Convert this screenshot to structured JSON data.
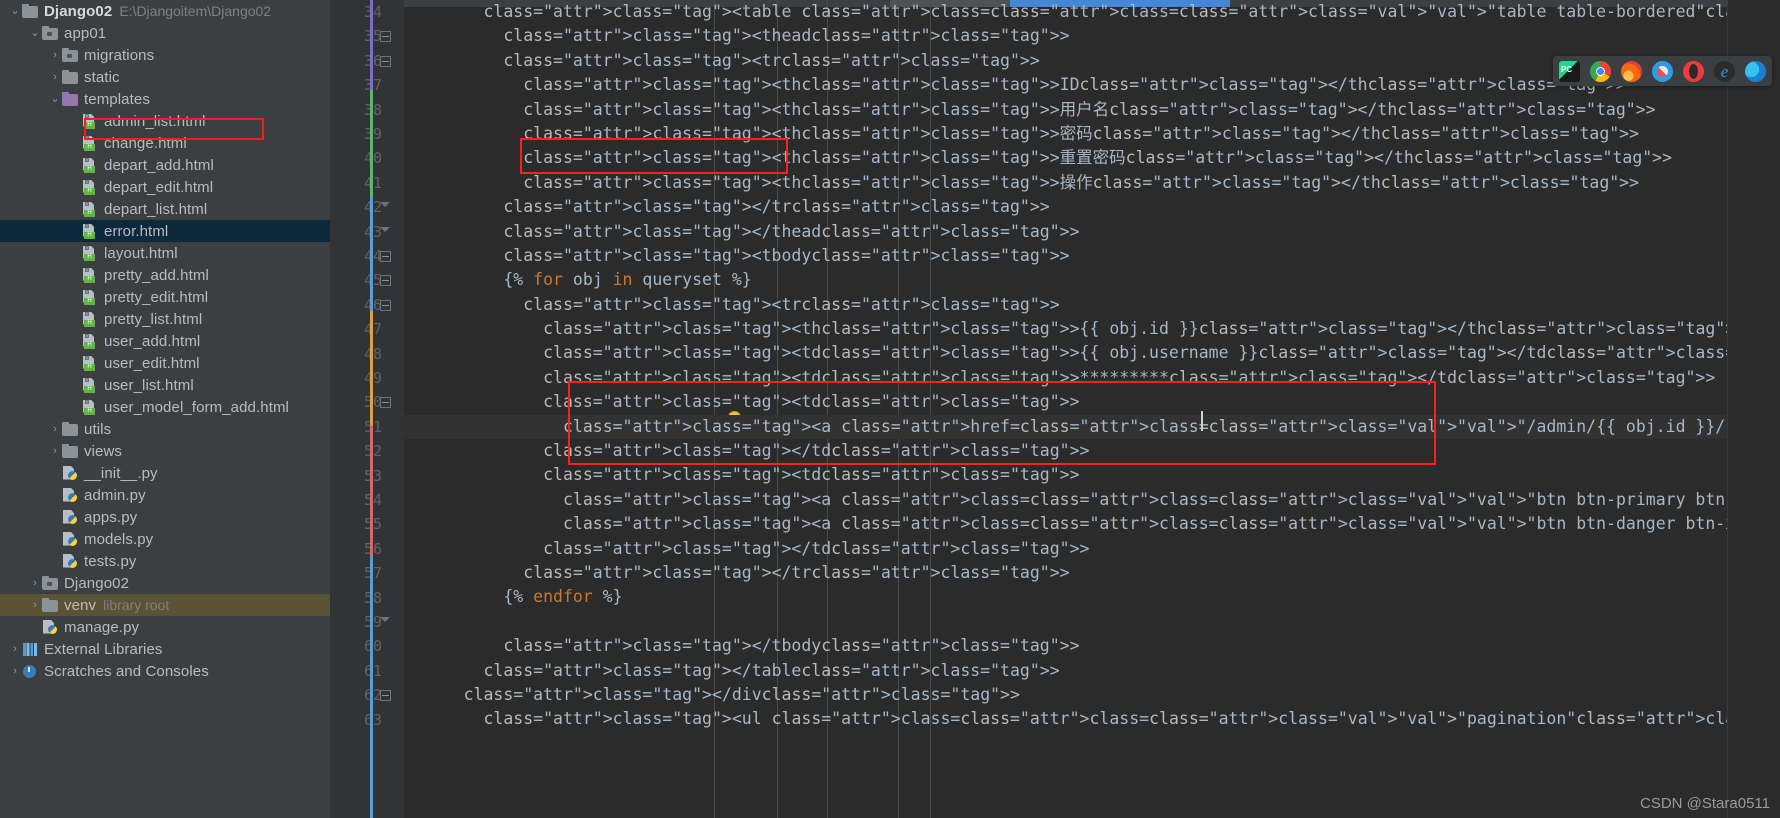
{
  "project": {
    "root": {
      "name": "Django02",
      "path": "E:\\Djangoitem\\Django02"
    },
    "items": [
      {
        "label": "Django02",
        "sub": "E:\\Djangoitem\\Django02",
        "icon": "folder-icon",
        "arrow": "⌄",
        "depth": 0,
        "bold": true
      },
      {
        "label": "app01",
        "sub": "",
        "icon": "module-folder-icon",
        "arrow": "⌄",
        "depth": 1,
        "bold": false
      },
      {
        "label": "migrations",
        "sub": "",
        "icon": "module-folder-icon",
        "arrow": "›",
        "depth": 2,
        "bold": false
      },
      {
        "label": "static",
        "sub": "",
        "icon": "folder-icon",
        "arrow": "›",
        "depth": 2,
        "bold": false
      },
      {
        "label": "templates",
        "sub": "",
        "icon": "templates-folder-icon",
        "arrow": "⌄",
        "depth": 2,
        "bold": false
      },
      {
        "label": "admin_list.html",
        "sub": "",
        "icon": "html-file-icon",
        "arrow": "",
        "depth": 3,
        "bold": false
      },
      {
        "label": "change.html",
        "sub": "",
        "icon": "html-file-icon",
        "arrow": "",
        "depth": 3,
        "bold": false
      },
      {
        "label": "depart_add.html",
        "sub": "",
        "icon": "html-file-icon",
        "arrow": "",
        "depth": 3,
        "bold": false
      },
      {
        "label": "depart_edit.html",
        "sub": "",
        "icon": "html-file-icon",
        "arrow": "",
        "depth": 3,
        "bold": false
      },
      {
        "label": "depart_list.html",
        "sub": "",
        "icon": "html-file-icon",
        "arrow": "",
        "depth": 3,
        "bold": false
      },
      {
        "label": "error.html",
        "sub": "",
        "icon": "html-file-icon",
        "arrow": "",
        "depth": 3,
        "bold": false,
        "selected": true
      },
      {
        "label": "layout.html",
        "sub": "",
        "icon": "html-file-icon",
        "arrow": "",
        "depth": 3,
        "bold": false
      },
      {
        "label": "pretty_add.html",
        "sub": "",
        "icon": "html-file-icon",
        "arrow": "",
        "depth": 3,
        "bold": false
      },
      {
        "label": "pretty_edit.html",
        "sub": "",
        "icon": "html-file-icon",
        "arrow": "",
        "depth": 3,
        "bold": false
      },
      {
        "label": "pretty_list.html",
        "sub": "",
        "icon": "html-file-icon",
        "arrow": "",
        "depth": 3,
        "bold": false
      },
      {
        "label": "user_add.html",
        "sub": "",
        "icon": "html-file-icon",
        "arrow": "",
        "depth": 3,
        "bold": false
      },
      {
        "label": "user_edit.html",
        "sub": "",
        "icon": "html-file-icon",
        "arrow": "",
        "depth": 3,
        "bold": false
      },
      {
        "label": "user_list.html",
        "sub": "",
        "icon": "html-file-icon",
        "arrow": "",
        "depth": 3,
        "bold": false
      },
      {
        "label": "user_model_form_add.html",
        "sub": "",
        "icon": "html-file-icon",
        "arrow": "",
        "depth": 3,
        "bold": false
      },
      {
        "label": "utils",
        "sub": "",
        "icon": "folder-icon",
        "arrow": "›",
        "depth": 2,
        "bold": false
      },
      {
        "label": "views",
        "sub": "",
        "icon": "folder-icon",
        "arrow": "›",
        "depth": 2,
        "bold": false
      },
      {
        "label": "__init__.py",
        "sub": "",
        "icon": "python-file-icon",
        "arrow": "",
        "depth": 2,
        "bold": false
      },
      {
        "label": "admin.py",
        "sub": "",
        "icon": "python-file-icon",
        "arrow": "",
        "depth": 2,
        "bold": false
      },
      {
        "label": "apps.py",
        "sub": "",
        "icon": "python-file-icon",
        "arrow": "",
        "depth": 2,
        "bold": false
      },
      {
        "label": "models.py",
        "sub": "",
        "icon": "python-file-icon",
        "arrow": "",
        "depth": 2,
        "bold": false
      },
      {
        "label": "tests.py",
        "sub": "",
        "icon": "python-file-icon",
        "arrow": "",
        "depth": 2,
        "bold": false
      },
      {
        "label": "Django02",
        "sub": "",
        "icon": "module-folder-icon",
        "arrow": "›",
        "depth": 1,
        "bold": false
      },
      {
        "label": "venv",
        "sub": "library root",
        "icon": "folder-icon",
        "arrow": "›",
        "depth": 1,
        "bold": false,
        "venv": true
      },
      {
        "label": "manage.py",
        "sub": "",
        "icon": "python-file-icon",
        "arrow": "",
        "depth": 1,
        "bold": false
      },
      {
        "label": "External Libraries",
        "sub": "",
        "icon": "external-libraries-icon",
        "arrow": "›",
        "depth": 0,
        "bold": false
      },
      {
        "label": "Scratches and Consoles",
        "sub": "",
        "icon": "scratches-icon",
        "arrow": "›",
        "depth": 0,
        "bold": false
      }
    ]
  },
  "editor": {
    "first_line": 34,
    "current_line": 51,
    "lines": [
      {
        "n": 34,
        "indent": 8,
        "text": "<table class=\"table table-bordered\">"
      },
      {
        "n": 35,
        "indent": 10,
        "text": "<thead>"
      },
      {
        "n": 36,
        "indent": 10,
        "text": "<tr>"
      },
      {
        "n": 37,
        "indent": 12,
        "text": "<th>ID</th>"
      },
      {
        "n": 38,
        "indent": 12,
        "text": "<th>用户名</th>"
      },
      {
        "n": 39,
        "indent": 12,
        "text": "<th>密码</th>"
      },
      {
        "n": 40,
        "indent": 12,
        "text": "<th>重置密码</th>"
      },
      {
        "n": 41,
        "indent": 12,
        "text": "<th>操作</th>"
      },
      {
        "n": 42,
        "indent": 10,
        "text": "</tr>"
      },
      {
        "n": 43,
        "indent": 10,
        "text": "</thead>"
      },
      {
        "n": 44,
        "indent": 10,
        "text": "<tbody>"
      },
      {
        "n": 45,
        "indent": 10,
        "text": "{% for obj in queryset %}"
      },
      {
        "n": 46,
        "indent": 12,
        "text": "<tr>"
      },
      {
        "n": 47,
        "indent": 14,
        "text": "<th>{{ obj.id }}</th>"
      },
      {
        "n": 48,
        "indent": 14,
        "text": "<td>{{ obj.username }}</td>"
      },
      {
        "n": 49,
        "indent": 14,
        "text": "<td>*********</td>"
      },
      {
        "n": 50,
        "indent": 14,
        "text": "<td>"
      },
      {
        "n": 51,
        "indent": 16,
        "text": "<a href=\"/admin/{{ obj.id }}/reset/\">重置密码</a>"
      },
      {
        "n": 52,
        "indent": 14,
        "text": "</td>"
      },
      {
        "n": 53,
        "indent": 14,
        "text": "<td>"
      },
      {
        "n": 54,
        "indent": 16,
        "text": "<a class=\"btn btn-primary btn-xs\" href=\"/admin/{{ obj.id }}/edit/\">编辑</a>"
      },
      {
        "n": 55,
        "indent": 16,
        "text": "<a class=\"btn btn-danger btn-xs\" href=\"/admin/{{ obj.id }}/delete/\">删除</a>"
      },
      {
        "n": 56,
        "indent": 14,
        "text": "</td>"
      },
      {
        "n": 57,
        "indent": 12,
        "text": "</tr>"
      },
      {
        "n": 58,
        "indent": 10,
        "text": "{% endfor %}"
      },
      {
        "n": 59,
        "indent": 0,
        "text": ""
      },
      {
        "n": 60,
        "indent": 10,
        "text": "</tbody>"
      },
      {
        "n": 61,
        "indent": 8,
        "text": "</table>"
      },
      {
        "n": 62,
        "indent": 6,
        "text": "</div>"
      },
      {
        "n": 63,
        "indent": 8,
        "text": "<ul class=\"pagination\">"
      }
    ]
  },
  "toolbar": {
    "browsers": [
      {
        "name": "pycharm-icon",
        "label": "PC"
      },
      {
        "name": "chrome-icon",
        "label": ""
      },
      {
        "name": "firefox-icon",
        "label": ""
      },
      {
        "name": "safari-icon",
        "label": ""
      },
      {
        "name": "opera-icon",
        "label": ""
      },
      {
        "name": "internet-explorer-icon",
        "label": "e"
      },
      {
        "name": "edge-icon",
        "label": ""
      }
    ]
  },
  "watermark": {
    "text": "CSDN @Stara0511"
  },
  "colors": {
    "accent_red": "#fb2020",
    "selection_blue": "#0d293e",
    "editor_bg": "#2b2b2b",
    "panel_bg": "#3c3f41",
    "tag_orange": "#e8bf6a",
    "string_green": "#6a8759"
  }
}
